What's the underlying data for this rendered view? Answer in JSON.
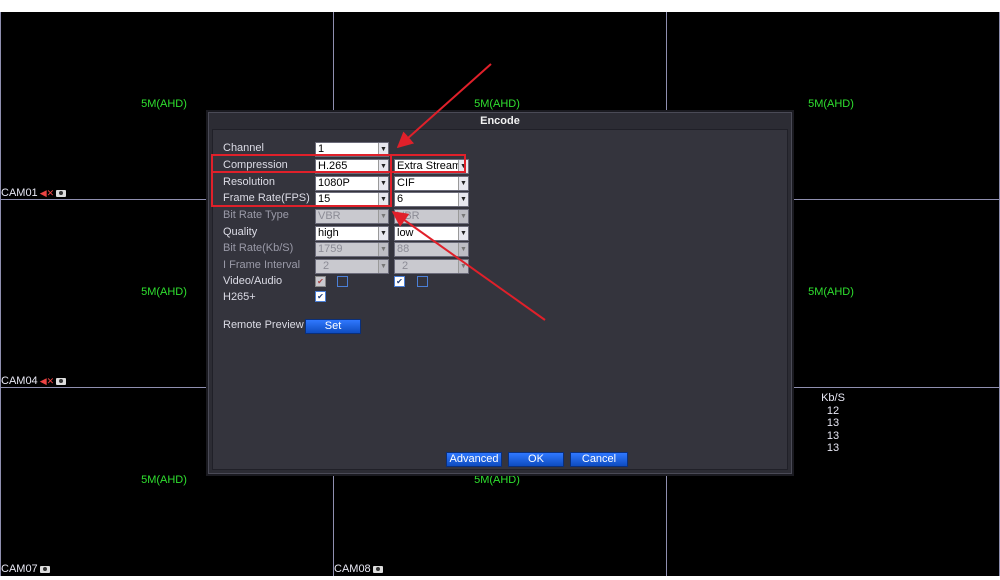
{
  "cameras": {
    "resolution_label": "5M(AHD)",
    "cam01": "CAM01",
    "cam04": "CAM04",
    "cam07": "CAM07",
    "cam08": "CAM08"
  },
  "bitrate_panel": {
    "header": "Kb/S",
    "values": [
      "12",
      "13",
      "13",
      "13"
    ]
  },
  "dialog": {
    "title": "Encode",
    "rows": {
      "channel": {
        "label": "Channel",
        "main": "1"
      },
      "compression": {
        "label": "Compression",
        "main": "H.265",
        "extra": "Extra Stream"
      },
      "resolution": {
        "label": "Resolution",
        "main": "1080P",
        "extra": "CIF"
      },
      "frame_rate": {
        "label": "Frame Rate(FPS)",
        "main": "15",
        "extra": "6"
      },
      "bit_rate_type": {
        "label": "Bit Rate Type",
        "main": "VBR",
        "extra": "VBR"
      },
      "quality": {
        "label": "Quality",
        "main": "high",
        "extra": "low"
      },
      "bit_rate": {
        "label": "Bit Rate(Kb/S)",
        "main": "1759",
        "extra": "88"
      },
      "i_frame": {
        "label": "I Frame Interval",
        "main": "2",
        "extra": "2"
      },
      "video_audio": {
        "label": "Video/Audio"
      },
      "h265plus": {
        "label": "H265+"
      }
    },
    "remote_preview": {
      "label": "Remote Preview",
      "button": "Set"
    },
    "buttons": {
      "advanced": "Advanced",
      "ok": "OK",
      "cancel": "Cancel"
    }
  },
  "colors": {
    "annotation": "#e0202a",
    "resolution_text": "#2fe02f",
    "button_blue": "#1a5fe0"
  },
  "icons": {
    "speaker": "speaker-muted-icon",
    "record": "record-icon",
    "dropdown": "dropdown-arrow-icon",
    "checkbox": "checkbox-icon"
  }
}
